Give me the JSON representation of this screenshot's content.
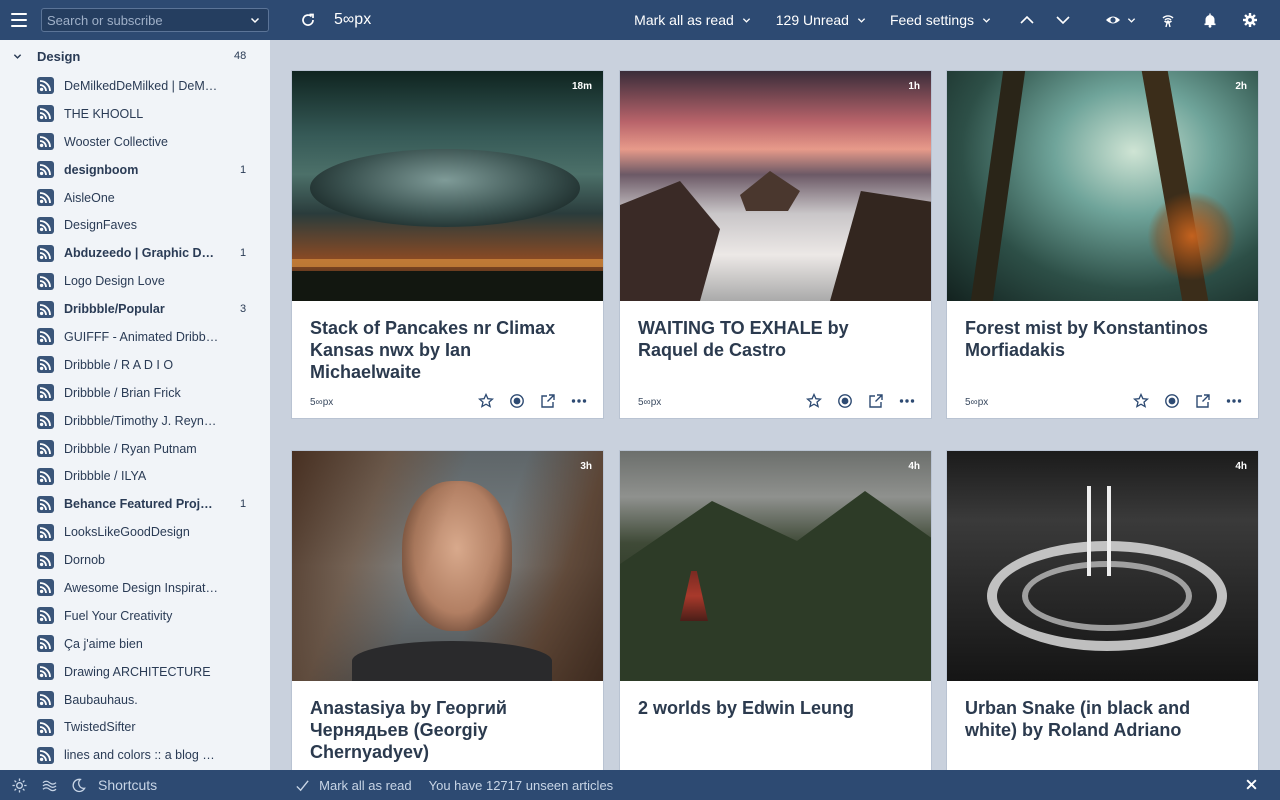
{
  "topbar": {
    "search_placeholder": "Search or subscribe",
    "feed_title": "5∞px",
    "mark_all_read": "Mark all as read",
    "unread": "129 Unread",
    "feed_settings": "Feed settings"
  },
  "sidebar": {
    "folder": {
      "name": "Design",
      "count": "48"
    },
    "feeds": [
      {
        "label": "DeMilkedDeMilked | DeMil…",
        "count": "",
        "bold": false
      },
      {
        "label": "THE KHOOLL",
        "count": "",
        "bold": false
      },
      {
        "label": "Wooster Collective",
        "count": "",
        "bold": false
      },
      {
        "label": "designboom",
        "count": "1",
        "bold": true
      },
      {
        "label": "AisleOne",
        "count": "",
        "bold": false
      },
      {
        "label": "DesignFaves",
        "count": "",
        "bold": false
      },
      {
        "label": "Abduzeedo | Graphic De…",
        "count": "1",
        "bold": true
      },
      {
        "label": "Logo Design Love",
        "count": "",
        "bold": false
      },
      {
        "label": "Dribbble/Popular",
        "count": "3",
        "bold": true
      },
      {
        "label": "GUIFFF - Animated Dribb…",
        "count": "",
        "bold": false
      },
      {
        "label": "Dribbble / R A D I O",
        "count": "",
        "bold": false
      },
      {
        "label": "Dribbble / Brian Frick",
        "count": "",
        "bold": false
      },
      {
        "label": "Dribbble/Timothy J. Reyno…",
        "count": "",
        "bold": false
      },
      {
        "label": "Dribbble / Ryan Putnam",
        "count": "",
        "bold": false
      },
      {
        "label": "Dribbble / ILYA",
        "count": "",
        "bold": false
      },
      {
        "label": "Behance Featured Proje…",
        "count": "1",
        "bold": true
      },
      {
        "label": "LooksLikeGoodDesign",
        "count": "",
        "bold": false
      },
      {
        "label": "Dornob",
        "count": "",
        "bold": false
      },
      {
        "label": "Awesome Design Inspiration",
        "count": "",
        "bold": false
      },
      {
        "label": "Fuel Your Creativity",
        "count": "",
        "bold": false
      },
      {
        "label": "Ça j'aime bien",
        "count": "",
        "bold": false
      },
      {
        "label": "Drawing ARCHITECTURE",
        "count": "",
        "bold": false
      },
      {
        "label": "Baubauhaus.",
        "count": "",
        "bold": false
      },
      {
        "label": "TwistedSifter",
        "count": "",
        "bold": false
      },
      {
        "label": "lines and colors :: a blog a…",
        "count": "",
        "bold": false
      }
    ]
  },
  "cards": [
    {
      "age": "18m",
      "title": "Stack of Pancakes nr Climax Kansas nwx by Ian Michaelwaite",
      "source": "5∞px",
      "image": "storm-photo"
    },
    {
      "age": "1h",
      "title": "WAITING TO EXHALE by Raquel de Castro",
      "source": "5∞px",
      "image": "seascape-photo"
    },
    {
      "age": "2h",
      "title": "Forest mist by Konstantinos Morfiadakis",
      "source": "5∞px",
      "image": "forest-photo"
    },
    {
      "age": "3h",
      "title": "Anastasiya by Георгий Чернядьев (Georgiy Chernyadyev)",
      "source": "",
      "image": "portrait-photo"
    },
    {
      "age": "4h",
      "title": "2 worlds by Edwin Leung",
      "source": "",
      "image": "mountain-pagoda-photo"
    },
    {
      "age": "4h",
      "title": "Urban Snake (in black and white) by Roland Adriano",
      "source": "",
      "image": "city-interchange-photo"
    }
  ],
  "bottombar": {
    "shortcuts": "Shortcuts",
    "mark_all_read": "Mark all as read",
    "unseen": "You have 12717 unseen articles"
  },
  "colors": {
    "topbar_bg": "#2d4a72",
    "sidebar_bg": "#f1f4f8",
    "main_bg": "#c9d1dd",
    "rss_icon": "#3a5579"
  }
}
